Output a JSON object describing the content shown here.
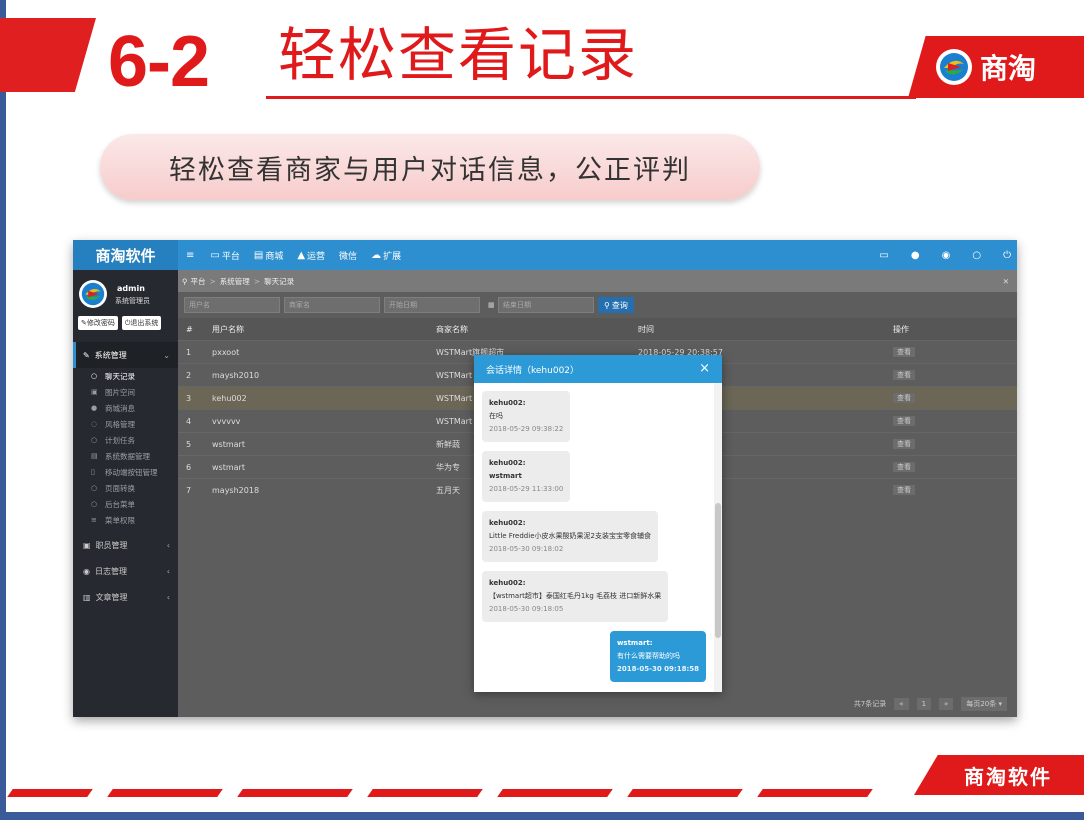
{
  "slide": {
    "number": "6-2",
    "title": "轻松查看记录",
    "subtitle": "轻松查看商家与用户对话信息，公正评判",
    "brand_logo_text": "商淘",
    "footer_logo_text": "商淘软件",
    "accent_color": "#e01a1a"
  },
  "app": {
    "brand": "商淘软件",
    "nav": [
      {
        "icon": "≡",
        "label": ""
      },
      {
        "icon": "▭",
        "label": "平台"
      },
      {
        "icon": "▤",
        "label": "商城"
      },
      {
        "icon": "▲",
        "label": "运营"
      },
      {
        "icon": "",
        "label": "微信"
      },
      {
        "icon": "☁",
        "label": "扩展"
      }
    ],
    "user": {
      "name": "admin",
      "role": "系统管理员",
      "change_pwd": "修改密码",
      "logout": "退出系统"
    },
    "menu": {
      "system": "系统管理",
      "subs": [
        "聊天记录",
        "图片空间",
        "商城消息",
        "风格管理",
        "计划任务",
        "系统数据管理",
        "移动端按钮管理",
        "页面转换",
        "后台菜单",
        "菜单权限"
      ],
      "groups": [
        "职员管理",
        "日志管理",
        "文章管理"
      ]
    },
    "breadcrumb": {
      "home": "平台",
      "section": "系统管理",
      "page": "聊天记录",
      "sep": ">"
    },
    "filter": {
      "user_ph": "用户名",
      "shop_ph": "商家名",
      "start_ph": "开始日期",
      "end_ph": "结束日期",
      "search": "查询"
    },
    "table": {
      "headers": {
        "no": "#",
        "user": "用户名称",
        "shop": "商家名称",
        "time": "时间",
        "op": "操作"
      },
      "rows": [
        {
          "no": "1",
          "user": "pxxoot",
          "shop": "WSTMart旗舰超市",
          "time": "2018-05-29 20:38:57",
          "op": "查看"
        },
        {
          "no": "2",
          "user": "maysh2010",
          "shop": "WSTMart",
          "time": "",
          "op": "查看"
        },
        {
          "no": "3",
          "user": "kehu002",
          "shop": "WSTMart",
          "time": "",
          "op": "查看"
        },
        {
          "no": "4",
          "user": "vvvvvv",
          "shop": "WSTMart",
          "time": "",
          "op": "查看"
        },
        {
          "no": "5",
          "user": "wstmart",
          "shop": "新鲜蔬",
          "time": "",
          "op": "查看"
        },
        {
          "no": "6",
          "user": "wstmart",
          "shop": "华为专",
          "time": "",
          "op": "查看"
        },
        {
          "no": "7",
          "user": "maysh2018",
          "shop": "五月天",
          "time": "",
          "op": "查看"
        }
      ]
    },
    "pager": {
      "total": "共7条记录",
      "prev": "«",
      "page": "1",
      "next": "»",
      "per_page": "每页20条 ▾"
    }
  },
  "modal": {
    "title": "会话详情（kehu002）",
    "close": "×",
    "messages": [
      {
        "sender": "kehu002:",
        "text": "在吗",
        "time": "2018-05-29 09:38:22",
        "mine": false
      },
      {
        "sender": "kehu002:",
        "text": "wstmart",
        "time": "2018-05-29 11:33:00",
        "mine": false
      },
      {
        "sender": "kehu002:",
        "text": "Little Freddie小皮水果酸奶果泥2支装宝宝零食辅食",
        "time": "2018-05-30 09:18:02",
        "mine": false
      },
      {
        "sender": "kehu002:",
        "text": "【wstmart超市】泰国红毛丹1kg 毛荔枝 进口新鲜水果",
        "time": "2018-05-30 09:18:05",
        "mine": false
      },
      {
        "sender": "wstmart:",
        "text": "有什么需要帮助的吗",
        "time": "2018-05-30 09:18:58",
        "mine": true
      }
    ]
  }
}
